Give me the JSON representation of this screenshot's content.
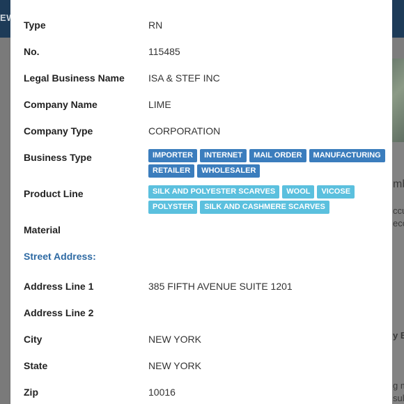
{
  "background": {
    "left_text": "EW",
    "right_fragments": [
      "mb",
      "ccu",
      "eco",
      "y B",
      "g m",
      "sult"
    ]
  },
  "fields": [
    {
      "label": "Type",
      "value": "RN"
    },
    {
      "label": "No.",
      "value": "115485"
    },
    {
      "label": "Legal Business Name",
      "value": "ISA & STEF INC"
    },
    {
      "label": "Company Name",
      "value": "LIME"
    },
    {
      "label": "Company Type",
      "value": "CORPORATION"
    }
  ],
  "business_type": {
    "label": "Business Type",
    "tags": [
      "IMPORTER",
      "INTERNET",
      "MAIL ORDER",
      "MANUFACTURING",
      "RETAILER",
      "WHOLESALER"
    ]
  },
  "product_line": {
    "label": "Product Line",
    "tags": [
      "SILK AND POLYESTER SCARVES",
      "WOOL",
      "VICOSE",
      "POLYSTER",
      "SILK AND CASHMERE SCARVES"
    ]
  },
  "material": {
    "label": "Material",
    "value": ""
  },
  "street_address_title": "Street Address:",
  "address": [
    {
      "label": "Address Line 1",
      "value": "385 FIFTH AVENUE SUITE 1201"
    },
    {
      "label": "Address Line 2",
      "value": ""
    },
    {
      "label": "City",
      "value": "NEW YORK"
    },
    {
      "label": "State",
      "value": "NEW YORK"
    },
    {
      "label": "Zip",
      "value": "10016"
    }
  ],
  "colors": {
    "tag_blue": "#3b7dbd",
    "tag_cyan": "#5bc0de",
    "section_title": "#2e6aa3"
  }
}
